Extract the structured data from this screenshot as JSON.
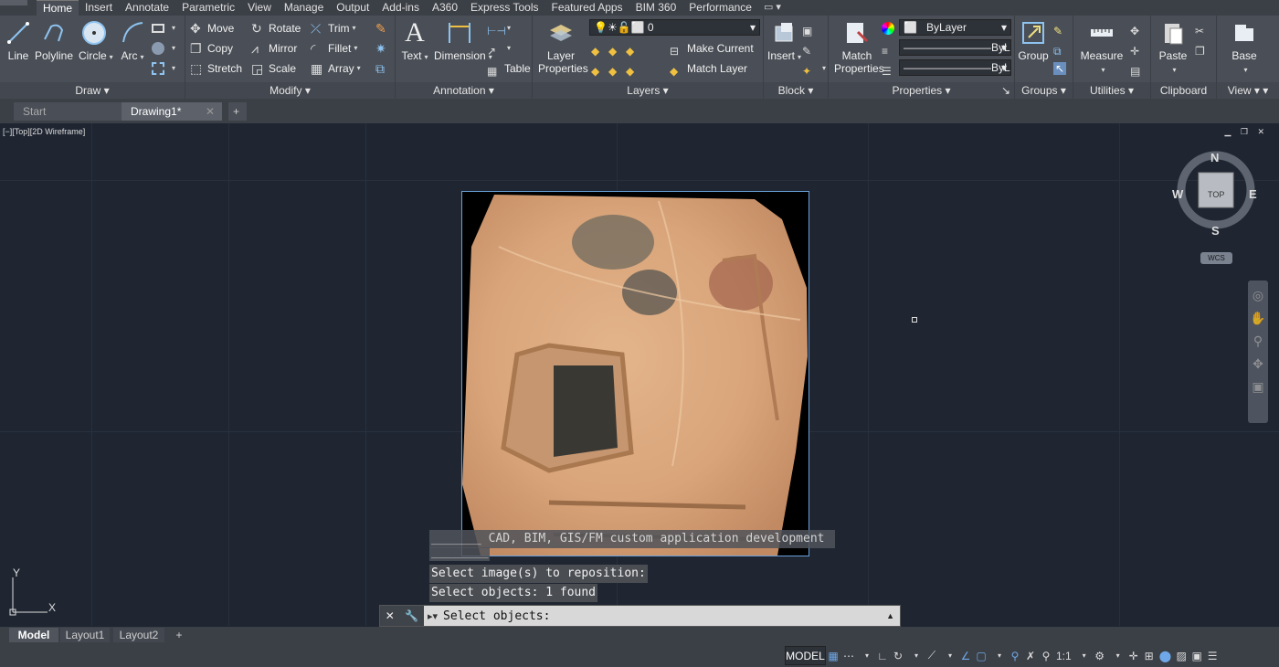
{
  "menu": {
    "tabs": [
      "Home",
      "Insert",
      "Annotate",
      "Parametric",
      "View",
      "Manage",
      "Output",
      "Add-ins",
      "A360",
      "Express Tools",
      "Featured Apps",
      "BIM 360",
      "Performance"
    ]
  },
  "ribbon": {
    "draw": {
      "label": "Draw",
      "line": "Line",
      "polyline": "Polyline",
      "circle": "Circle",
      "arc": "Arc"
    },
    "modify": {
      "label": "Modify",
      "move": "Move",
      "rotate": "Rotate",
      "trim": "Trim",
      "copy": "Copy",
      "mirror": "Mirror",
      "fillet": "Fillet",
      "stretch": "Stretch",
      "scale": "Scale",
      "array": "Array"
    },
    "annotation": {
      "label": "Annotation",
      "text": "Text",
      "dimension": "Dimension",
      "table": "Table"
    },
    "layers": {
      "label": "Layers",
      "layer_properties_1": "Layer",
      "layer_properties_2": "Properties",
      "current_layer": "0",
      "make_current": "Make Current",
      "match_layer": "Match Layer"
    },
    "block": {
      "label": "Block",
      "insert": "Insert"
    },
    "properties": {
      "label": "Properties",
      "match_1": "Match",
      "match_2": "Properties",
      "color": "ByLayer",
      "linetype": "ByLayer",
      "lineweight": "ByLayer"
    },
    "groups": {
      "label": "Groups",
      "group": "Group"
    },
    "utilities": {
      "label": "Utilities",
      "measure": "Measure"
    },
    "clipboard": {
      "label": "Clipboard",
      "paste": "Paste"
    },
    "view": {
      "label": "View",
      "base": "Base"
    }
  },
  "file_tabs": {
    "start": "Start",
    "drawing": "Drawing1*"
  },
  "viewport": {
    "label": "[−][Top][2D Wireframe]",
    "compass": {
      "n": "N",
      "s": "S",
      "e": "E",
      "w": "W",
      "top": "TOP",
      "wcs": "WCS"
    },
    "ucs": {
      "x": "X",
      "y": "Y"
    }
  },
  "command": {
    "line_1": "_______ CAD, BIM, GIS/FM custom application development",
    "line_1b": "________",
    "line_2": "Select image(s) to reposition:",
    "line_3": "Select objects: 1 found",
    "prompt": "Select objects:"
  },
  "layout_tabs": {
    "model": "Model",
    "layout1": "Layout1",
    "layout2": "Layout2"
  },
  "status": {
    "model": "MODEL",
    "scale": "1:1"
  }
}
